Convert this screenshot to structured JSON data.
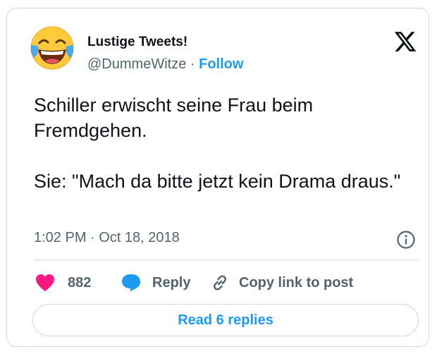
{
  "author": {
    "display_name": "Lustige Tweets!",
    "handle": "@DummeWitze",
    "separator": "·",
    "follow_label": "Follow",
    "avatar_icon": "face-with-tears-of-joy-emoji"
  },
  "brand": {
    "logo_icon": "x-logo-icon"
  },
  "tweet": {
    "lines": [
      "Schiller erwischt seine Frau beim Fremdgehen.",
      "Sie: \"Mach da bitte jetzt kein Drama draus.\""
    ],
    "timestamp": "1:02 PM · Oct 18, 2018"
  },
  "actions": {
    "like_count": "882",
    "reply_label": "Reply",
    "copy_link_label": "Copy link to post"
  },
  "replies_button": {
    "label": "Read 6 replies"
  },
  "colors": {
    "accent": "#1d9bf0",
    "like": "#f91880",
    "text": "#0f1419",
    "muted": "#536471",
    "border": "#cfd9de"
  }
}
